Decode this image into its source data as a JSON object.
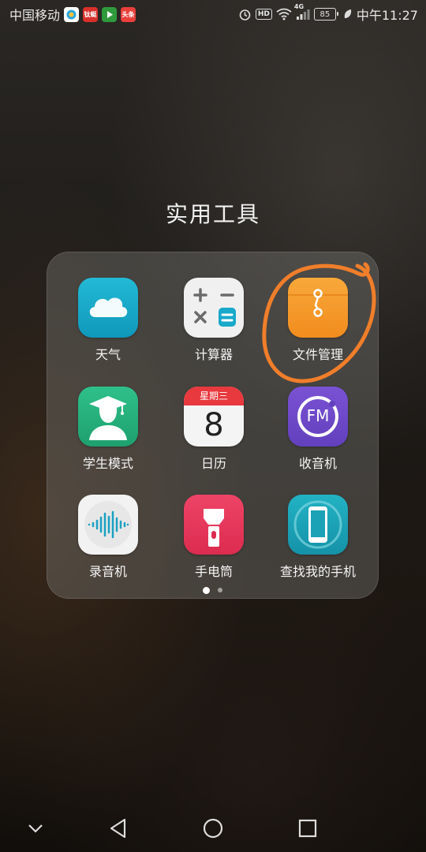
{
  "status_bar": {
    "carrier": "中国移动",
    "notif1": "",
    "notif2": "钛蜓",
    "notif3": "",
    "notif4": "头条",
    "signal_label": "4G",
    "battery": "85",
    "time": "中午11:27"
  },
  "folder": {
    "title": "实用工具",
    "apps": [
      {
        "label": "天气",
        "icon": "weather-icon"
      },
      {
        "label": "计算器",
        "icon": "calculator-icon"
      },
      {
        "label": "文件管理",
        "icon": "file-manager-icon"
      },
      {
        "label": "学生模式",
        "icon": "student-mode-icon"
      },
      {
        "label": "日历",
        "icon": "calendar-icon"
      },
      {
        "label": "收音机",
        "icon": "radio-icon"
      },
      {
        "label": "录音机",
        "icon": "recorder-icon"
      },
      {
        "label": "手电筒",
        "icon": "flashlight-icon"
      },
      {
        "label": "查找我的手机",
        "icon": "find-my-phone-icon"
      }
    ],
    "calendar_weekday": "星期三",
    "calendar_day": "8",
    "radio_label": "FM",
    "page_count": 2,
    "active_page": 1
  },
  "colors": {
    "annotation": "#f07e2a",
    "weather": "#16a9c9",
    "file_manager": "#f39a2a",
    "student": "#23b07a",
    "radio": "#6f47c8",
    "flashlight": "#e8375c",
    "find_phone": "#1ba2b6",
    "calendar_red": "#e83a3f"
  }
}
